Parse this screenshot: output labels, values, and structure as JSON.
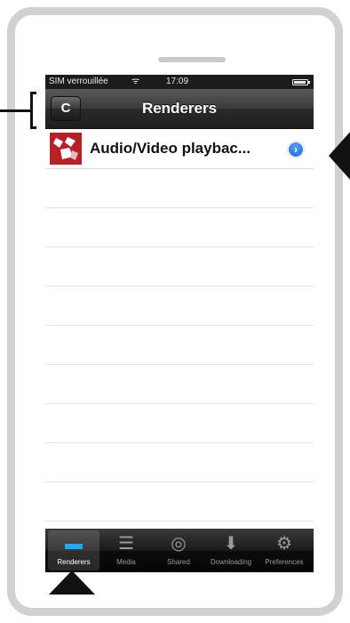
{
  "status_bar": {
    "carrier": "SIM verrouillée",
    "time": "17:09",
    "wifi_icon": "wifi-icon",
    "battery_icon": "battery-icon"
  },
  "nav_bar": {
    "title": "Renderers",
    "refresh_icon": "C"
  },
  "renderers": [
    {
      "name": "Audio/Video playbac...",
      "logo_icon": "renderer-logo-icon",
      "accessory_icon": "disclosure-icon"
    }
  ],
  "tab_bar": {
    "items": [
      {
        "label": "Renderers",
        "icon": "▬",
        "active": true
      },
      {
        "label": "Media",
        "icon": "☰",
        "active": false
      },
      {
        "label": "Shared",
        "icon": "◎",
        "active": false
      },
      {
        "label": "Downloading",
        "icon": "⬇",
        "active": false
      },
      {
        "label": "Preferences",
        "icon": "⚙",
        "active": false
      }
    ]
  },
  "colors": {
    "accent_blue": "#1c64d8",
    "tab_active_blue": "#28a8e8",
    "logo_red": "#b52126"
  }
}
